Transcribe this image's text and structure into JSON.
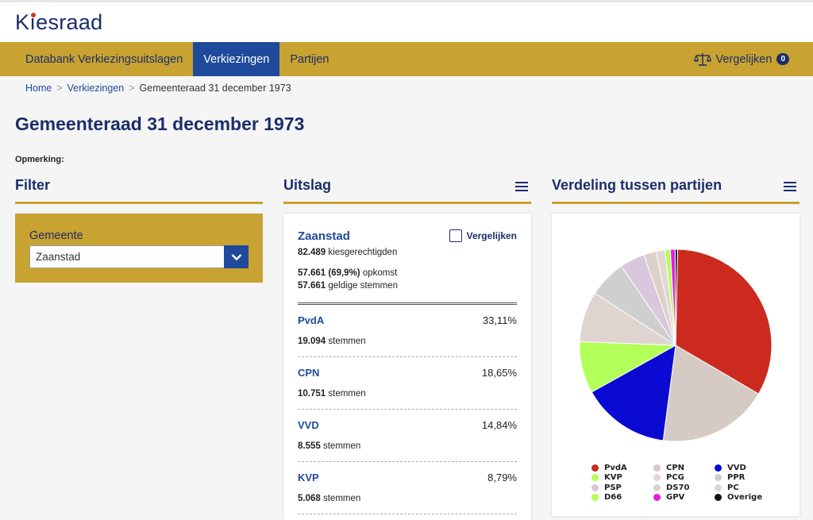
{
  "brand": {
    "name_pre": "K",
    "name_post": "esraad"
  },
  "nav": {
    "items": [
      {
        "label": "Databank Verkiezingsuitslagen"
      },
      {
        "label": "Verkiezingen"
      },
      {
        "label": "Partijen"
      }
    ],
    "active_index": 1,
    "compare_label": "Vergelijken",
    "compare_count": "0"
  },
  "breadcrumb": {
    "home": "Home",
    "level2": "Verkiezingen",
    "current": "Gemeenteraad 31 december 1973",
    "separator": ">"
  },
  "page": {
    "title": "Gemeenteraad 31 december 1973",
    "remark_label": "Opmerking:"
  },
  "filter": {
    "heading": "Filter",
    "field_label": "Gemeente",
    "selected_value": "Zaanstad"
  },
  "result": {
    "heading": "Uitslag",
    "municipality": "Zaanstad",
    "compare_label": "Vergelijken",
    "eligible_num": "82.489",
    "eligible_label": "kiesgerechtigden",
    "turnout_num": "57.661 (69,9%)",
    "turnout_label": "opkomst",
    "valid_num": "57.661",
    "valid_label": "geldige stemmen",
    "votes_suffix": "stemmen",
    "parties": [
      {
        "name": "PvdA",
        "pct": "33,11%",
        "votes": "19.094"
      },
      {
        "name": "CPN",
        "pct": "18,65%",
        "votes": "10.751"
      },
      {
        "name": "VVD",
        "pct": "14,84%",
        "votes": "8.555"
      },
      {
        "name": "KVP",
        "pct": "8,79%",
        "votes": "5.068"
      }
    ]
  },
  "distribution": {
    "heading": "Verdeling tussen partijen"
  },
  "chart_data": {
    "type": "pie",
    "title": "",
    "slices": [
      {
        "name": "PvdA",
        "value": 33.11,
        "color": "#cc2a1f"
      },
      {
        "name": "CPN",
        "value": 18.65,
        "color": "#d6cac4"
      },
      {
        "name": "VVD",
        "value": 14.84,
        "color": "#0a0ad2"
      },
      {
        "name": "D66",
        "value": 8.7,
        "color": "#b3ff59"
      },
      {
        "name": "PC",
        "value": 8.5,
        "color": "#e0d4d0"
      },
      {
        "name": "PPR",
        "value": 6.3,
        "color": "#cfcfcf"
      },
      {
        "name": "PSP",
        "value": 4.2,
        "color": "#d9c7dc"
      },
      {
        "name": "DS70",
        "value": 2.1,
        "color": "#dcd1c9"
      },
      {
        "name": "PCG",
        "value": 1.5,
        "color": "#e2d7d2"
      },
      {
        "name": "KVP",
        "value": 0.9,
        "color": "#b3ff59"
      },
      {
        "name": "GPV",
        "value": 0.8,
        "color": "#e31ce3"
      },
      {
        "name": "Overige",
        "value": 0.4,
        "color": "#111111"
      }
    ],
    "legend": [
      {
        "name": "PvdA",
        "color": "#cc2a1f"
      },
      {
        "name": "CPN",
        "color": "#d6cac4"
      },
      {
        "name": "VVD",
        "color": "#0a0ad2"
      },
      {
        "name": "KVP",
        "color": "#b3ff59"
      },
      {
        "name": "PCG",
        "color": "#e2d7d2"
      },
      {
        "name": "PPR",
        "color": "#cfcfcf"
      },
      {
        "name": "PSP",
        "color": "#d9c7dc"
      },
      {
        "name": "DS70",
        "color": "#dcd1c9"
      },
      {
        "name": "PC",
        "color": "#e0d4d0"
      },
      {
        "name": "D66",
        "color": "#b3ff59"
      },
      {
        "name": "GPV",
        "color": "#e31ce3"
      },
      {
        "name": "Overige",
        "color": "#111111"
      }
    ],
    "legend_placement": "bottom"
  }
}
